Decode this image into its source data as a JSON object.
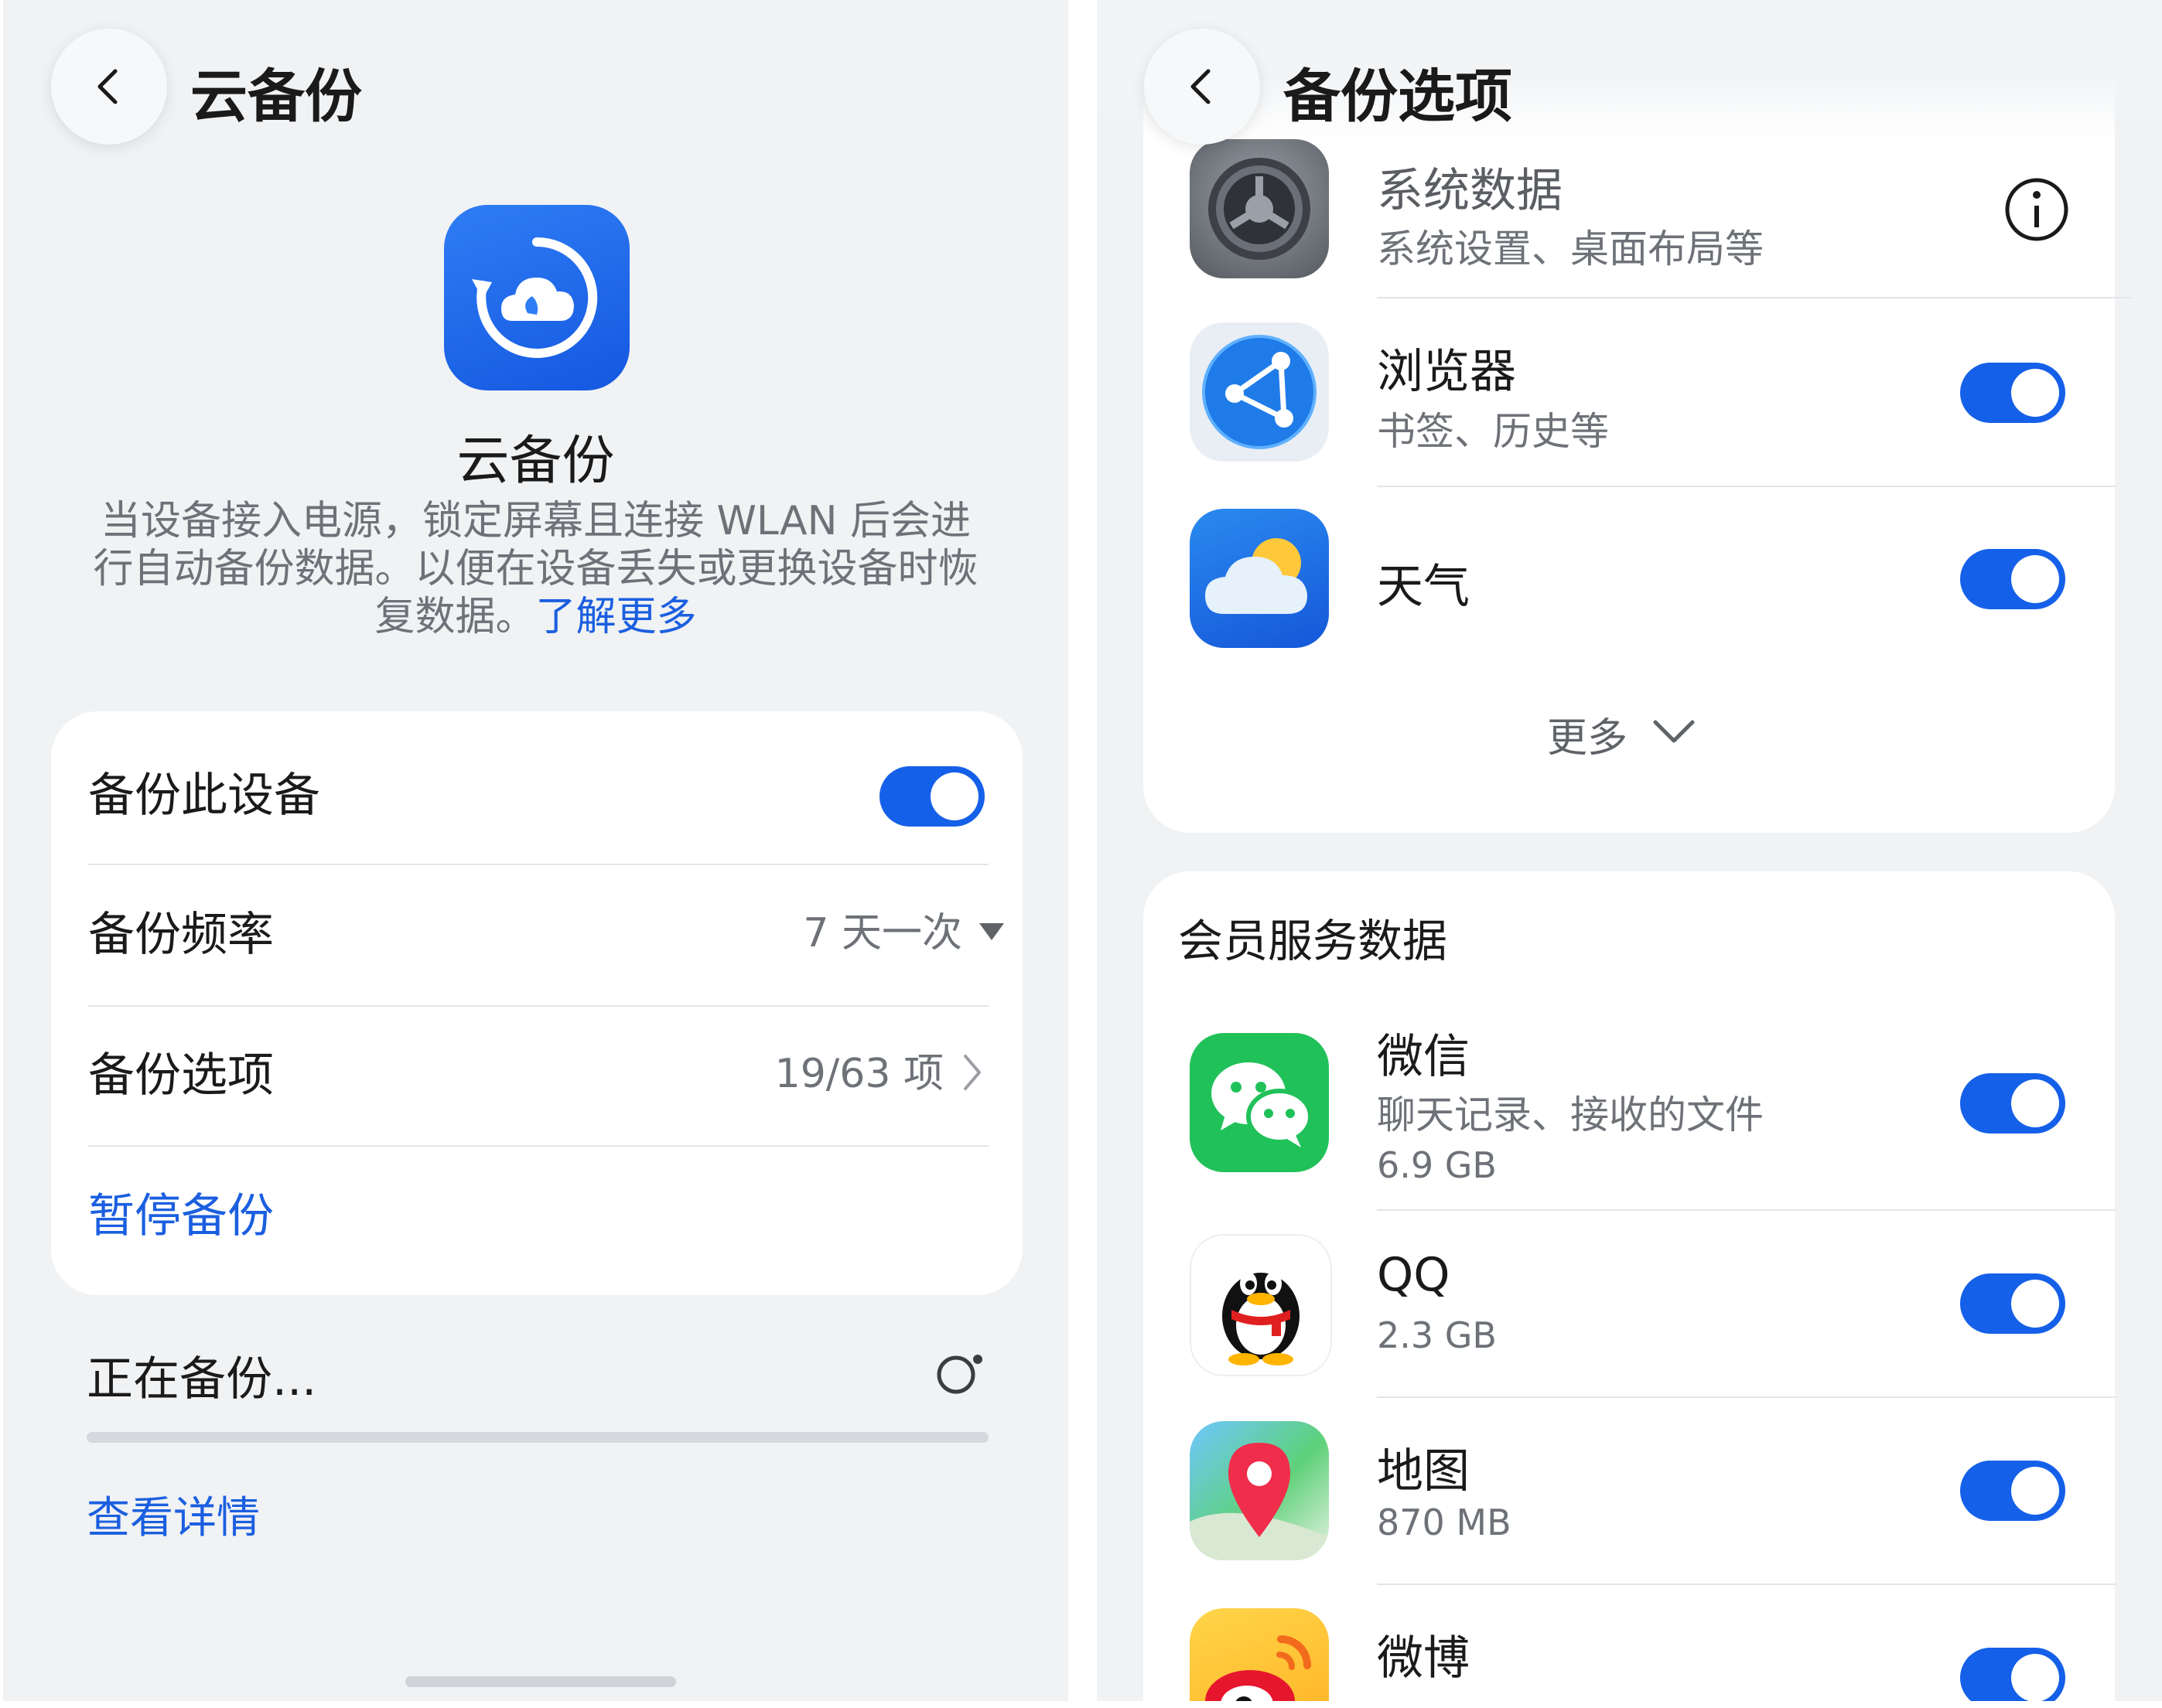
{
  "left": {
    "header": {
      "title": "云备份"
    },
    "app": {
      "name": "云备份",
      "description_lines": [
        "当设备接入电源，锁定屏幕且连接 WLAN 后会进",
        "行自动备份数据。以便在设备丢失或更换设备时恢",
        "复数据。"
      ],
      "learn_more": "了解更多"
    },
    "settings": {
      "backup_device": {
        "label": "备份此设备",
        "enabled": true
      },
      "frequency": {
        "label": "备份频率",
        "value": "7 天一次"
      },
      "options": {
        "label": "备份选项",
        "value": "19/63 项"
      },
      "pause": {
        "label": "暂停备份"
      }
    },
    "status": {
      "label": "正在备份...",
      "details_link": "查看详情"
    }
  },
  "right": {
    "header": {
      "title": "备份选项"
    },
    "system_items": [
      {
        "title": "系统数据",
        "subtitle": "系统设置、桌面布局等",
        "icon": "gear-icon"
      },
      {
        "title": "浏览器",
        "subtitle": "书签、历史等",
        "icon": "browser-icon",
        "enabled": true
      },
      {
        "title": "天气",
        "icon": "weather-icon",
        "enabled": true
      }
    ],
    "more_label": "更多",
    "member_section": {
      "title": "会员服务数据",
      "items": [
        {
          "title": "微信",
          "subtitle": "聊天记录、接收的文件",
          "size": "6.9 GB",
          "icon": "wechat-icon",
          "enabled": true
        },
        {
          "title": "QQ",
          "size": "2.3 GB",
          "icon": "qq-icon",
          "enabled": true
        },
        {
          "title": "地图",
          "size": "870 MB",
          "icon": "map-icon",
          "enabled": true
        },
        {
          "title": "微博",
          "icon": "weibo-icon",
          "enabled": true
        }
      ]
    }
  },
  "colors": {
    "accent": "#1560e8",
    "link": "#1b5fe0",
    "background": "#f0f2f4"
  }
}
